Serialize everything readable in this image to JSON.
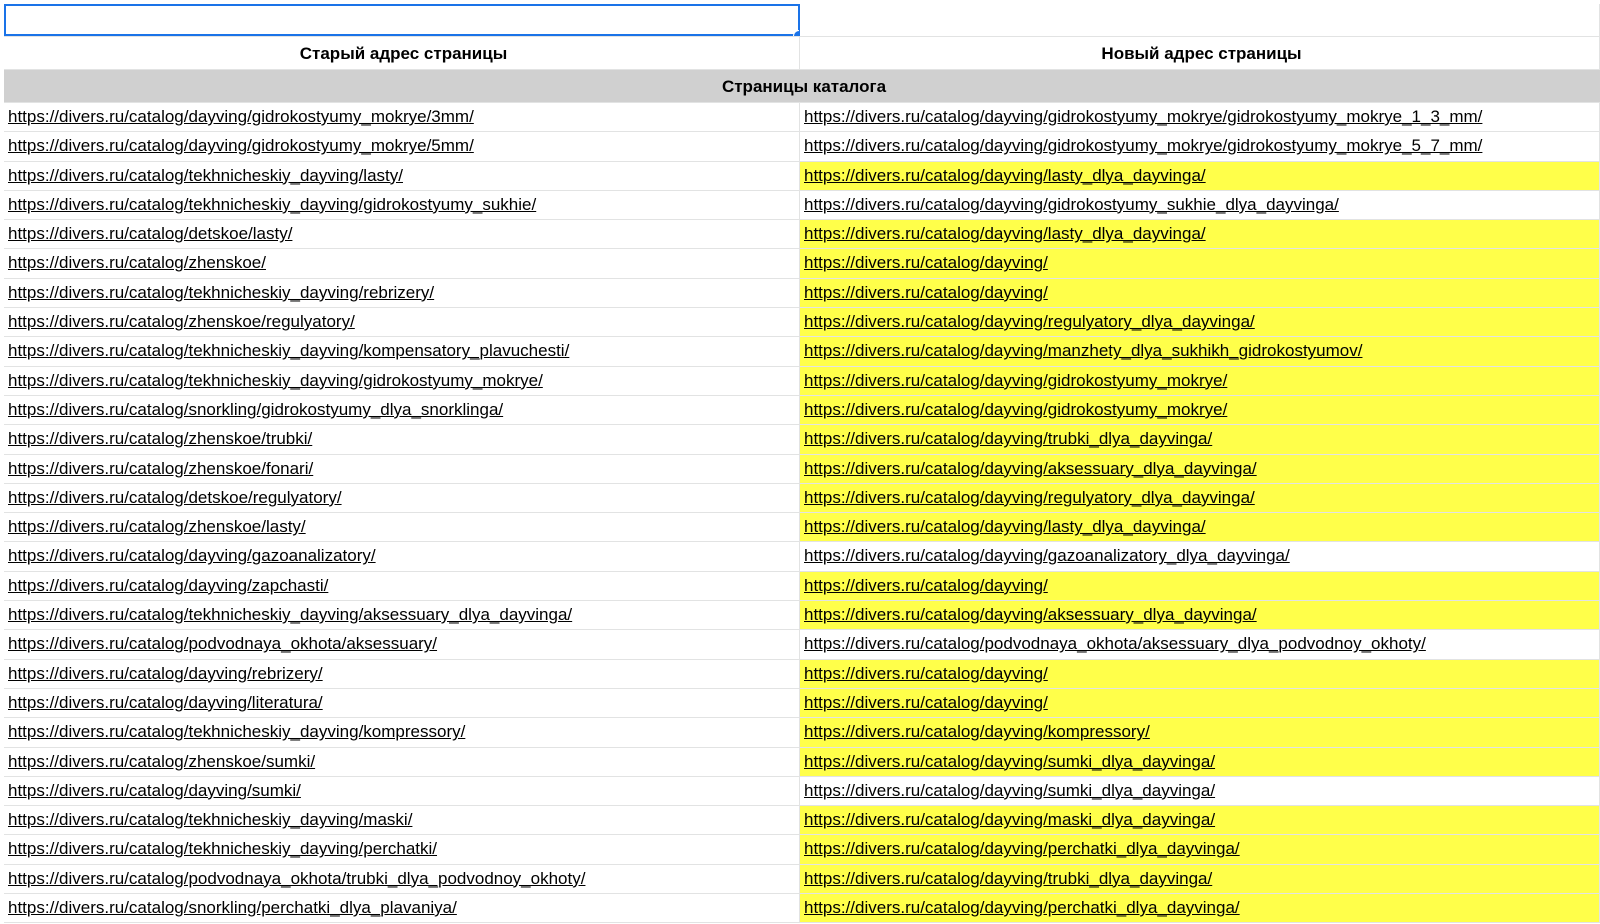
{
  "headers": {
    "old": "Старый адрес страницы",
    "new": "Новый адрес страницы"
  },
  "section_title": "Страницы каталога",
  "highlight_color": "#ffff4a",
  "rows": [
    {
      "old": "https://divers.ru/catalog/dayving/gidrokostyumy_mokrye/3mm/",
      "new": "https://divers.ru/catalog/dayving/gidrokostyumy_mokrye/gidrokostyumy_mokrye_1_3_mm/",
      "highlight": false
    },
    {
      "old": "https://divers.ru/catalog/dayving/gidrokostyumy_mokrye/5mm/",
      "new": "https://divers.ru/catalog/dayving/gidrokostyumy_mokrye/gidrokostyumy_mokrye_5_7_mm/",
      "highlight": false
    },
    {
      "old": "https://divers.ru/catalog/tekhnicheskiy_dayving/lasty/",
      "new": "https://divers.ru/catalog/dayving/lasty_dlya_dayvinga/",
      "highlight": true
    },
    {
      "old": "https://divers.ru/catalog/tekhnicheskiy_dayving/gidrokostyumy_sukhie/",
      "new": "https://divers.ru/catalog/dayving/gidrokostyumy_sukhie_dlya_dayvinga/",
      "highlight": false
    },
    {
      "old": "https://divers.ru/catalog/detskoe/lasty/",
      "new": "https://divers.ru/catalog/dayving/lasty_dlya_dayvinga/",
      "highlight": true
    },
    {
      "old": "https://divers.ru/catalog/zhenskoe/",
      "new": "https://divers.ru/catalog/dayving/",
      "highlight": true
    },
    {
      "old": "https://divers.ru/catalog/tekhnicheskiy_dayving/rebrizery/",
      "new": "https://divers.ru/catalog/dayving/",
      "highlight": true
    },
    {
      "old": "https://divers.ru/catalog/zhenskoe/regulyatory/",
      "new": "https://divers.ru/catalog/dayving/regulyatory_dlya_dayvinga/",
      "highlight": true
    },
    {
      "old": "https://divers.ru/catalog/tekhnicheskiy_dayving/kompensatory_plavuchesti/",
      "new": "https://divers.ru/catalog/dayving/manzhety_dlya_sukhikh_gidrokostyumov/",
      "highlight": true
    },
    {
      "old": "https://divers.ru/catalog/tekhnicheskiy_dayving/gidrokostyumy_mokrye/",
      "new": "https://divers.ru/catalog/dayving/gidrokostyumy_mokrye/",
      "highlight": true
    },
    {
      "old": "https://divers.ru/catalog/snorkling/gidrokostyumy_dlya_snorklinga/",
      "new": "https://divers.ru/catalog/dayving/gidrokostyumy_mokrye/",
      "highlight": true
    },
    {
      "old": "https://divers.ru/catalog/zhenskoe/trubki/",
      "new": "https://divers.ru/catalog/dayving/trubki_dlya_dayvinga/",
      "highlight": true
    },
    {
      "old": "https://divers.ru/catalog/zhenskoe/fonari/",
      "new": "https://divers.ru/catalog/dayving/aksessuary_dlya_dayvinga/",
      "highlight": true
    },
    {
      "old": "https://divers.ru/catalog/detskoe/regulyatory/",
      "new": "https://divers.ru/catalog/dayving/regulyatory_dlya_dayvinga/",
      "highlight": true
    },
    {
      "old": "https://divers.ru/catalog/zhenskoe/lasty/",
      "new": "https://divers.ru/catalog/dayving/lasty_dlya_dayvinga/",
      "highlight": true
    },
    {
      "old": "https://divers.ru/catalog/dayving/gazoanalizatory/",
      "new": "https://divers.ru/catalog/dayving/gazoanalizatory_dlya_dayvinga/",
      "highlight": false
    },
    {
      "old": "https://divers.ru/catalog/dayving/zapchasti/",
      "new": "https://divers.ru/catalog/dayving/",
      "highlight": true
    },
    {
      "old": "https://divers.ru/catalog/tekhnicheskiy_dayving/aksessuary_dlya_dayvinga/",
      "new": "https://divers.ru/catalog/dayving/aksessuary_dlya_dayvinga/",
      "highlight": true
    },
    {
      "old": "https://divers.ru/catalog/podvodnaya_okhota/aksessuary/",
      "new": "https://divers.ru/catalog/podvodnaya_okhota/aksessuary_dlya_podvodnoy_okhoty/",
      "highlight": false
    },
    {
      "old": "https://divers.ru/catalog/dayving/rebrizery/",
      "new": "https://divers.ru/catalog/dayving/",
      "highlight": true
    },
    {
      "old": "https://divers.ru/catalog/dayving/literatura/",
      "new": "https://divers.ru/catalog/dayving/",
      "highlight": true
    },
    {
      "old": "https://divers.ru/catalog/tekhnicheskiy_dayving/kompressory/",
      "new": "https://divers.ru/catalog/dayving/kompressory/",
      "highlight": true
    },
    {
      "old": "https://divers.ru/catalog/zhenskoe/sumki/",
      "new": "https://divers.ru/catalog/dayving/sumki_dlya_dayvinga/",
      "highlight": true
    },
    {
      "old": "https://divers.ru/catalog/dayving/sumki/",
      "new": "https://divers.ru/catalog/dayving/sumki_dlya_dayvinga/",
      "highlight": false
    },
    {
      "old": "https://divers.ru/catalog/tekhnicheskiy_dayving/maski/",
      "new": "https://divers.ru/catalog/dayving/maski_dlya_dayvinga/",
      "highlight": true
    },
    {
      "old": "https://divers.ru/catalog/tekhnicheskiy_dayving/perchatki/",
      "new": "https://divers.ru/catalog/dayving/perchatki_dlya_dayvinga/",
      "highlight": true
    },
    {
      "old": "https://divers.ru/catalog/podvodnaya_okhota/trubki_dlya_podvodnoy_okhoty/",
      "new": "https://divers.ru/catalog/dayving/trubki_dlya_dayvinga/",
      "highlight": true
    },
    {
      "old": "https://divers.ru/catalog/snorkling/perchatki_dlya_plavaniya/",
      "new": "https://divers.ru/catalog/dayving/perchatki_dlya_dayvinga/",
      "highlight": true
    }
  ]
}
